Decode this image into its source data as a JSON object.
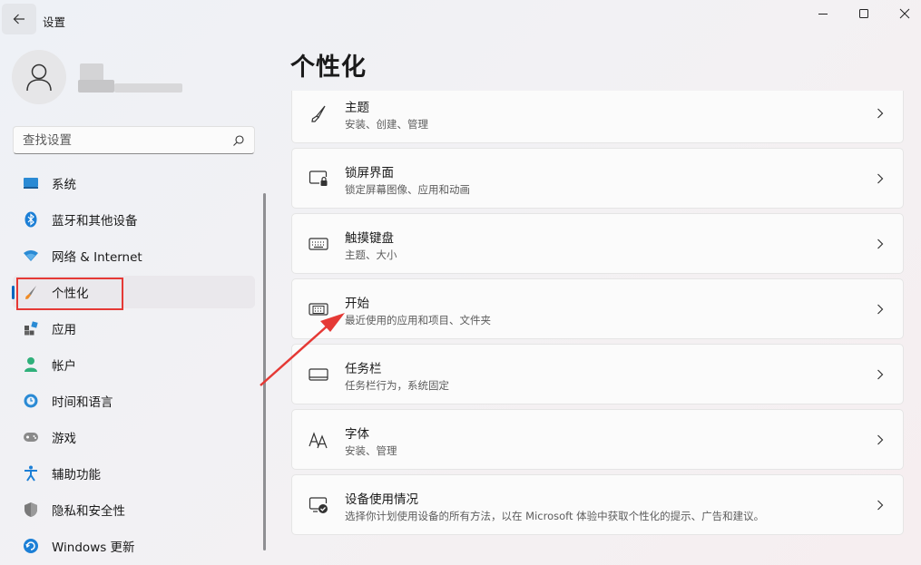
{
  "window": {
    "title": "设置"
  },
  "search": {
    "placeholder": "查找设置",
    "value": ""
  },
  "sidebar": {
    "items": [
      {
        "label": "系统",
        "icon": "system-icon"
      },
      {
        "label": "蓝牙和其他设备",
        "icon": "bluetooth-icon"
      },
      {
        "label": "网络 & Internet",
        "icon": "wifi-icon"
      },
      {
        "label": "个性化",
        "icon": "brush-icon",
        "active": true
      },
      {
        "label": "应用",
        "icon": "apps-icon"
      },
      {
        "label": "帐户",
        "icon": "account-icon"
      },
      {
        "label": "时间和语言",
        "icon": "time-language-icon"
      },
      {
        "label": "游戏",
        "icon": "gamepad-icon"
      },
      {
        "label": "辅助功能",
        "icon": "accessibility-icon"
      },
      {
        "label": "隐私和安全性",
        "icon": "shield-icon"
      },
      {
        "label": "Windows 更新",
        "icon": "update-icon"
      }
    ]
  },
  "main": {
    "title": "个性化",
    "cards": [
      {
        "title": "主题",
        "desc": "安装、创建、管理",
        "icon": "pen-icon"
      },
      {
        "title": "锁屏界面",
        "desc": "锁定屏幕图像、应用和动画",
        "icon": "lock-screen-icon"
      },
      {
        "title": "触摸键盘",
        "desc": "主题、大小",
        "icon": "keyboard-icon"
      },
      {
        "title": "开始",
        "desc": "最近使用的应用和项目、文件夹",
        "icon": "start-menu-icon"
      },
      {
        "title": "任务栏",
        "desc": "任务栏行为，系统固定",
        "icon": "taskbar-icon"
      },
      {
        "title": "字体",
        "desc": "安装、管理",
        "icon": "font-icon"
      },
      {
        "title": "设备使用情况",
        "desc": "选择你计划使用设备的所有方法，以在 Microsoft 体验中获取个性化的提示、广告和建议。",
        "icon": "device-usage-icon"
      }
    ]
  },
  "colors": {
    "accent": "#0067c0",
    "annotation": "#e53935"
  }
}
